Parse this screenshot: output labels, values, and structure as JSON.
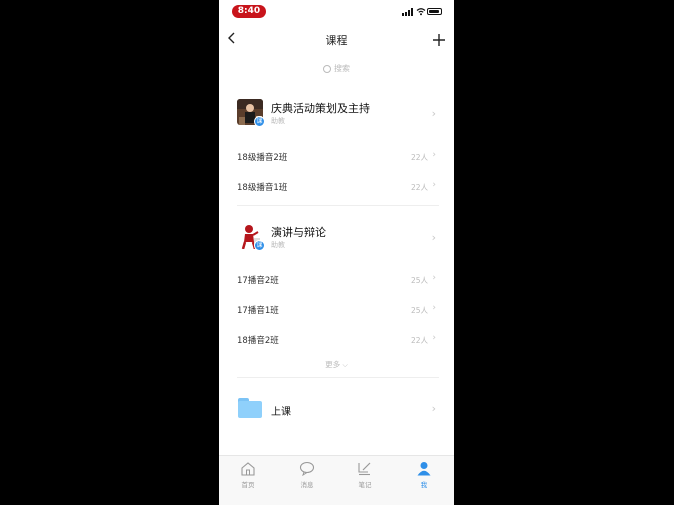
{
  "status": {
    "time": "8:40"
  },
  "nav": {
    "title": "课程",
    "back_icon": "chevron-left-icon",
    "add_icon": "plus-icon"
  },
  "search": {
    "placeholder": "搜索"
  },
  "courses": [
    {
      "name": "庆典活动策划及主持",
      "subtitle": "助教",
      "badge": "课",
      "classes": [
        {
          "name": "18级播音2班",
          "count": "22人"
        },
        {
          "name": "18级播音1班",
          "count": "22人"
        }
      ]
    },
    {
      "name": "演讲与辩论",
      "subtitle": "助教",
      "badge": "课",
      "classes": [
        {
          "name": "17播音2班",
          "count": "25人"
        },
        {
          "name": "17播音1班",
          "count": "25人"
        },
        {
          "name": "18播音2班",
          "count": "22人"
        }
      ]
    }
  ],
  "more_label": "更多",
  "folder": {
    "name": "上课"
  },
  "tabbar": [
    {
      "label": "首页",
      "icon": "home-icon"
    },
    {
      "label": "消息",
      "icon": "chat-bubble-icon"
    },
    {
      "label": "笔记",
      "icon": "note-edit-icon"
    },
    {
      "label": "我",
      "icon": "person-icon",
      "active": true
    }
  ],
  "colors": {
    "accent": "#2f8fe8",
    "time_pill": "#c8141b",
    "folder": "#8fd0fb"
  }
}
